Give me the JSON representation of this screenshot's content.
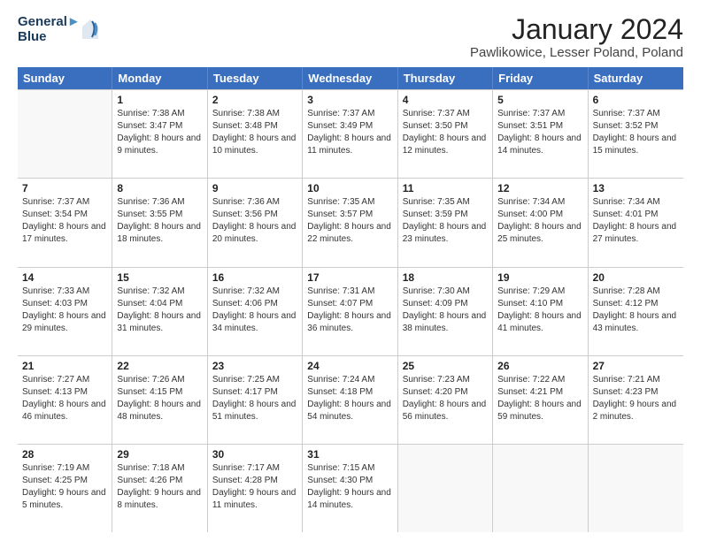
{
  "header": {
    "logo_line1": "General",
    "logo_line2": "Blue",
    "month": "January 2024",
    "location": "Pawlikowice, Lesser Poland, Poland"
  },
  "days": [
    "Sunday",
    "Monday",
    "Tuesday",
    "Wednesday",
    "Thursday",
    "Friday",
    "Saturday"
  ],
  "weeks": [
    [
      {
        "day": "",
        "sunrise": "",
        "sunset": "",
        "daylight": ""
      },
      {
        "day": "1",
        "sunrise": "Sunrise: 7:38 AM",
        "sunset": "Sunset: 3:47 PM",
        "daylight": "Daylight: 8 hours and 9 minutes."
      },
      {
        "day": "2",
        "sunrise": "Sunrise: 7:38 AM",
        "sunset": "Sunset: 3:48 PM",
        "daylight": "Daylight: 8 hours and 10 minutes."
      },
      {
        "day": "3",
        "sunrise": "Sunrise: 7:37 AM",
        "sunset": "Sunset: 3:49 PM",
        "daylight": "Daylight: 8 hours and 11 minutes."
      },
      {
        "day": "4",
        "sunrise": "Sunrise: 7:37 AM",
        "sunset": "Sunset: 3:50 PM",
        "daylight": "Daylight: 8 hours and 12 minutes."
      },
      {
        "day": "5",
        "sunrise": "Sunrise: 7:37 AM",
        "sunset": "Sunset: 3:51 PM",
        "daylight": "Daylight: 8 hours and 14 minutes."
      },
      {
        "day": "6",
        "sunrise": "Sunrise: 7:37 AM",
        "sunset": "Sunset: 3:52 PM",
        "daylight": "Daylight: 8 hours and 15 minutes."
      }
    ],
    [
      {
        "day": "7",
        "sunrise": "Sunrise: 7:37 AM",
        "sunset": "Sunset: 3:54 PM",
        "daylight": "Daylight: 8 hours and 17 minutes."
      },
      {
        "day": "8",
        "sunrise": "Sunrise: 7:36 AM",
        "sunset": "Sunset: 3:55 PM",
        "daylight": "Daylight: 8 hours and 18 minutes."
      },
      {
        "day": "9",
        "sunrise": "Sunrise: 7:36 AM",
        "sunset": "Sunset: 3:56 PM",
        "daylight": "Daylight: 8 hours and 20 minutes."
      },
      {
        "day": "10",
        "sunrise": "Sunrise: 7:35 AM",
        "sunset": "Sunset: 3:57 PM",
        "daylight": "Daylight: 8 hours and 22 minutes."
      },
      {
        "day": "11",
        "sunrise": "Sunrise: 7:35 AM",
        "sunset": "Sunset: 3:59 PM",
        "daylight": "Daylight: 8 hours and 23 minutes."
      },
      {
        "day": "12",
        "sunrise": "Sunrise: 7:34 AM",
        "sunset": "Sunset: 4:00 PM",
        "daylight": "Daylight: 8 hours and 25 minutes."
      },
      {
        "day": "13",
        "sunrise": "Sunrise: 7:34 AM",
        "sunset": "Sunset: 4:01 PM",
        "daylight": "Daylight: 8 hours and 27 minutes."
      }
    ],
    [
      {
        "day": "14",
        "sunrise": "Sunrise: 7:33 AM",
        "sunset": "Sunset: 4:03 PM",
        "daylight": "Daylight: 8 hours and 29 minutes."
      },
      {
        "day": "15",
        "sunrise": "Sunrise: 7:32 AM",
        "sunset": "Sunset: 4:04 PM",
        "daylight": "Daylight: 8 hours and 31 minutes."
      },
      {
        "day": "16",
        "sunrise": "Sunrise: 7:32 AM",
        "sunset": "Sunset: 4:06 PM",
        "daylight": "Daylight: 8 hours and 34 minutes."
      },
      {
        "day": "17",
        "sunrise": "Sunrise: 7:31 AM",
        "sunset": "Sunset: 4:07 PM",
        "daylight": "Daylight: 8 hours and 36 minutes."
      },
      {
        "day": "18",
        "sunrise": "Sunrise: 7:30 AM",
        "sunset": "Sunset: 4:09 PM",
        "daylight": "Daylight: 8 hours and 38 minutes."
      },
      {
        "day": "19",
        "sunrise": "Sunrise: 7:29 AM",
        "sunset": "Sunset: 4:10 PM",
        "daylight": "Daylight: 8 hours and 41 minutes."
      },
      {
        "day": "20",
        "sunrise": "Sunrise: 7:28 AM",
        "sunset": "Sunset: 4:12 PM",
        "daylight": "Daylight: 8 hours and 43 minutes."
      }
    ],
    [
      {
        "day": "21",
        "sunrise": "Sunrise: 7:27 AM",
        "sunset": "Sunset: 4:13 PM",
        "daylight": "Daylight: 8 hours and 46 minutes."
      },
      {
        "day": "22",
        "sunrise": "Sunrise: 7:26 AM",
        "sunset": "Sunset: 4:15 PM",
        "daylight": "Daylight: 8 hours and 48 minutes."
      },
      {
        "day": "23",
        "sunrise": "Sunrise: 7:25 AM",
        "sunset": "Sunset: 4:17 PM",
        "daylight": "Daylight: 8 hours and 51 minutes."
      },
      {
        "day": "24",
        "sunrise": "Sunrise: 7:24 AM",
        "sunset": "Sunset: 4:18 PM",
        "daylight": "Daylight: 8 hours and 54 minutes."
      },
      {
        "day": "25",
        "sunrise": "Sunrise: 7:23 AM",
        "sunset": "Sunset: 4:20 PM",
        "daylight": "Daylight: 8 hours and 56 minutes."
      },
      {
        "day": "26",
        "sunrise": "Sunrise: 7:22 AM",
        "sunset": "Sunset: 4:21 PM",
        "daylight": "Daylight: 8 hours and 59 minutes."
      },
      {
        "day": "27",
        "sunrise": "Sunrise: 7:21 AM",
        "sunset": "Sunset: 4:23 PM",
        "daylight": "Daylight: 9 hours and 2 minutes."
      }
    ],
    [
      {
        "day": "28",
        "sunrise": "Sunrise: 7:19 AM",
        "sunset": "Sunset: 4:25 PM",
        "daylight": "Daylight: 9 hours and 5 minutes."
      },
      {
        "day": "29",
        "sunrise": "Sunrise: 7:18 AM",
        "sunset": "Sunset: 4:26 PM",
        "daylight": "Daylight: 9 hours and 8 minutes."
      },
      {
        "day": "30",
        "sunrise": "Sunrise: 7:17 AM",
        "sunset": "Sunset: 4:28 PM",
        "daylight": "Daylight: 9 hours and 11 minutes."
      },
      {
        "day": "31",
        "sunrise": "Sunrise: 7:15 AM",
        "sunset": "Sunset: 4:30 PM",
        "daylight": "Daylight: 9 hours and 14 minutes."
      },
      {
        "day": "",
        "sunrise": "",
        "sunset": "",
        "daylight": ""
      },
      {
        "day": "",
        "sunrise": "",
        "sunset": "",
        "daylight": ""
      },
      {
        "day": "",
        "sunrise": "",
        "sunset": "",
        "daylight": ""
      }
    ]
  ]
}
